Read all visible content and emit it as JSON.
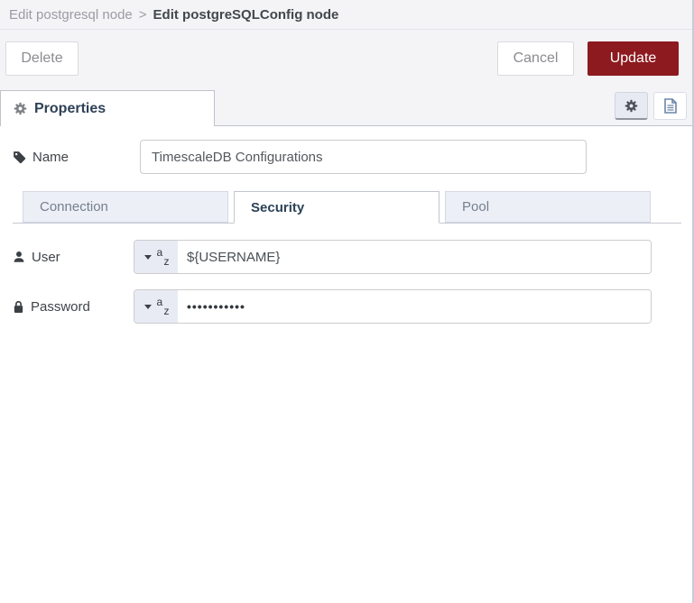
{
  "breadcrumb": {
    "parent": "Edit postgresql node",
    "separator": ">",
    "current": "Edit postgreSQLConfig node"
  },
  "toolbar": {
    "delete": "Delete",
    "cancel": "Cancel",
    "update": "Update"
  },
  "panel": {
    "properties_tab": "Properties"
  },
  "form": {
    "name": {
      "label": "Name",
      "value": "TimescaleDB Configurations"
    },
    "user": {
      "label": "User",
      "value": "${USERNAME}"
    },
    "password": {
      "label": "Password",
      "value": "•••••••••••"
    }
  },
  "typed_input": {
    "glyph_top": "a",
    "glyph_bottom": "z"
  },
  "tabs": [
    {
      "label": "Connection",
      "active": false
    },
    {
      "label": "Security",
      "active": true
    },
    {
      "label": "Pool",
      "active": false
    }
  ],
  "colors": {
    "update_button_red": "#8c1a1f",
    "header_background": "#f4f4f7",
    "active_tab_text": "#2e4156",
    "inactive_tab_background": "#edeff7",
    "typed_button_background": "#e8ebf4"
  }
}
